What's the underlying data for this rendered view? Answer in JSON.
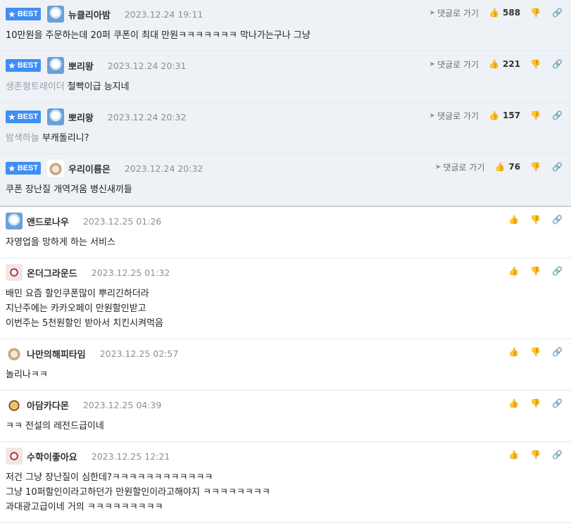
{
  "badge_label": "BEST",
  "reply_link_label": "댓글로 가기",
  "best_comments": [
    {
      "nickname": "뉴클리아밤",
      "date": "2023.12.24 19:11",
      "likes": "588",
      "quote": "",
      "text": "10만원을 주문하는데 20퍼 쿠폰이 최대 만원ㅋㅋㅋㅋㅋㅋㅋ 막나가는구나 그냥",
      "avatar": "blue"
    },
    {
      "nickname": "뽀리왕",
      "date": "2023.12.24 20:31",
      "likes": "221",
      "quote": "생존형트레이더",
      "text": "철빡이급 능지네",
      "avatar": "blue"
    },
    {
      "nickname": "뽀리왕",
      "date": "2023.12.24 20:32",
      "likes": "157",
      "quote": "밤색하늘",
      "text": "부캐돌리니?",
      "avatar": "blue"
    },
    {
      "nickname": "우리이름은",
      "date": "2023.12.24 20:32",
      "likes": "76",
      "quote": "",
      "text": "쿠폰 장난질 개역겨움 병신새끼들",
      "avatar": "pup"
    }
  ],
  "comments": [
    {
      "nickname": "앤드로나우",
      "date": "2023.12.25 01:26",
      "lines": [
        "자영업을 망하게 하는 서비스"
      ],
      "avatar": "blue"
    },
    {
      "nickname": "온더그라운드",
      "date": "2023.12.25 01:32",
      "lines": [
        "배민 요즘 할인쿠폰많이 뿌리긴하더라",
        "지난주에는 카카오페이 만원할인받고",
        "이번주는 5천원할인 받아서 치킨시켜먹음"
      ],
      "avatar": "dog"
    },
    {
      "nickname": "나만의해피타임",
      "date": "2023.12.25 02:57",
      "lines": [
        "놀리나ㅋㅋ"
      ],
      "avatar": "pup"
    },
    {
      "nickname": "아담카다몬",
      "date": "2023.12.25 04:39",
      "lines": [
        "ㅋㅋ 전설의 레전드급이네"
      ],
      "avatar": "fox"
    },
    {
      "nickname": "수학이좋아요",
      "date": "2023.12.25 12:21",
      "lines": [
        "저건 그냥 장난질이 심한데?ㅋㅋㅋㅋㅋㅋㅋㅋㅋㅋㅋㅋ",
        "그냥 10퍼할인이라고하던가 만원할인이라고해야지 ㅋㅋㅋㅋㅋㅋㅋㅋ",
        "과대광고급이네 거의 ㅋㅋㅋㅋㅋㅋㅋㅋㅋ"
      ],
      "avatar": "dog"
    }
  ],
  "icons": {
    "reply_arrow": "reply-arrow-icon",
    "like": "thumbs-up-icon",
    "dislike": "thumbs-down-icon",
    "share": "link-icon",
    "badge_star": "star-icon"
  }
}
